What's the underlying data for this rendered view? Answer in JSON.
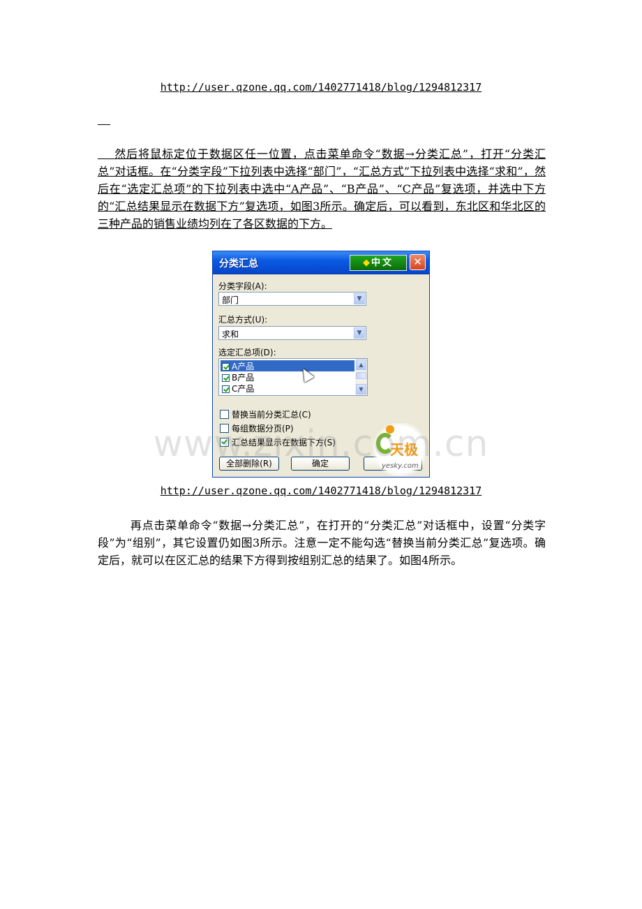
{
  "header_url": "http://user.qzone.qq.com/1402771418/blog/1294812317",
  "paragraph1": "    然后将鼠标定位于数据区任一位置，点击菜单命令“数据→分类汇总”，打开“分类汇总”对话框。在“分类字段”下拉列表中选择“部门”，“汇总方式”下拉列表中选择“求和”，然后在“选定汇总项”的下拉列表中选中“A产品”、“B产品”、“C产品”复选项，并选中下方的“汇总结果显示在数据下方”复选项，如图3所示。确定后，可以看到，东北区和华北区的三种产品的销售业绩均列在了各区数据的下方。",
  "dialog": {
    "title": "分类汇总",
    "ime_label": "中文",
    "close_glyph": "✕",
    "field_label": "分类字段(A):",
    "field_value": "部门",
    "method_label": "汇总方式(U):",
    "method_value": "求和",
    "items_label": "选定汇总项(D):",
    "items": [
      {
        "label": "A产品",
        "checked": true,
        "selected": true
      },
      {
        "label": "B产品",
        "checked": true,
        "selected": false
      },
      {
        "label": "C产品",
        "checked": true,
        "selected": false
      }
    ],
    "options": [
      {
        "label": "替换当前分类汇总(C)",
        "checked": false
      },
      {
        "label": "每组数据分页(P)",
        "checked": false
      },
      {
        "label": "汇总结果显示在数据下方(S)",
        "checked": true
      }
    ],
    "btn_delete": "全部删除(R)",
    "btn_ok": "确定",
    "btn_cancel": "取消",
    "logo_text": "天极",
    "logo_sub": "yesky.com"
  },
  "watermark": "www.zixin.com.cn",
  "caption_url": "http://user.qzone.qq.com/1402771418/blog/1294812317",
  "paragraph2": "        再点击菜单命令“数据→分类汇总”，在打开的“分类汇总”对话框中，设置“分类字段”为“组别”，其它设置仍如图3所示。注意一定不能勾选“替换当前分类汇总”复选项。确定后，就可以在区汇总的结果下方得到按组别汇总的结果了。如图4所示。"
}
